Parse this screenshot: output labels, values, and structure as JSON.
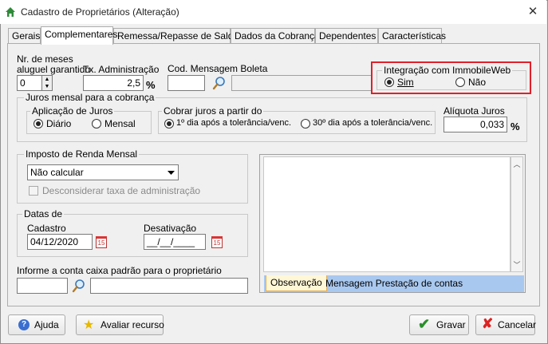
{
  "window": {
    "title": "Cadastro de Proprietários (Alteração)",
    "close": "✕"
  },
  "tabs": [
    "Gerais",
    "Complementares",
    "Remessa/Repasse de Saldo",
    "Dados da Cobrança",
    "Dependentes",
    "Características"
  ],
  "fields": {
    "meses_label_1": "Nr. de meses",
    "meses_label_2": "aluguel garantido",
    "meses_value": "0",
    "tx_label": "Tx. Administração",
    "tx_value": "2,5",
    "pct": "%",
    "cod_label": "Cod. Mensagem Boleta",
    "cod_value": "",
    "cod_desc": ""
  },
  "integracao": {
    "legend": "Integração com ImmobileWeb",
    "sim": "Sim",
    "nao": "Não"
  },
  "juros": {
    "legend": "Juros mensal para a cobrança",
    "aplicacao_legend": "Aplicação de Juros",
    "diario": "Diário",
    "mensal": "Mensal",
    "cobrar_legend": "Cobrar juros a partir do",
    "opt1": "1º dia após a tolerância/venc.",
    "opt2": "30º dia após a tolerância/venc.",
    "aliquota_label": "Alíquota Juros",
    "aliquota_value": "0,033",
    "pct": "%"
  },
  "imposto": {
    "legend": "Imposto de Renda Mensal",
    "select_value": "Não calcular",
    "checkbox_label": "Desconsiderar taxa de administração"
  },
  "datas": {
    "legend": "Datas de",
    "cadastro_label": "Cadastro",
    "cadastro_value": "04/12/2020",
    "desativacao_label": "Desativação",
    "desativacao_value": "__/__/____",
    "cal_icon": "15"
  },
  "conta": {
    "label": "Informe a conta caixa padrão para o proprietário",
    "code": "",
    "desc": ""
  },
  "memo": {
    "tab1": "Observação",
    "tab2": "Mensagem Prestação de contas",
    "text": ""
  },
  "buttons": {
    "ajuda": "Ajuda",
    "avaliar": "Avaliar recurso",
    "gravar": "Gravar",
    "cancelar": "Cancelar"
  },
  "colors": {
    "highlight": "#e0202a",
    "memo_tabs": "#a9c8ef",
    "accent": "#3a6fd1"
  }
}
